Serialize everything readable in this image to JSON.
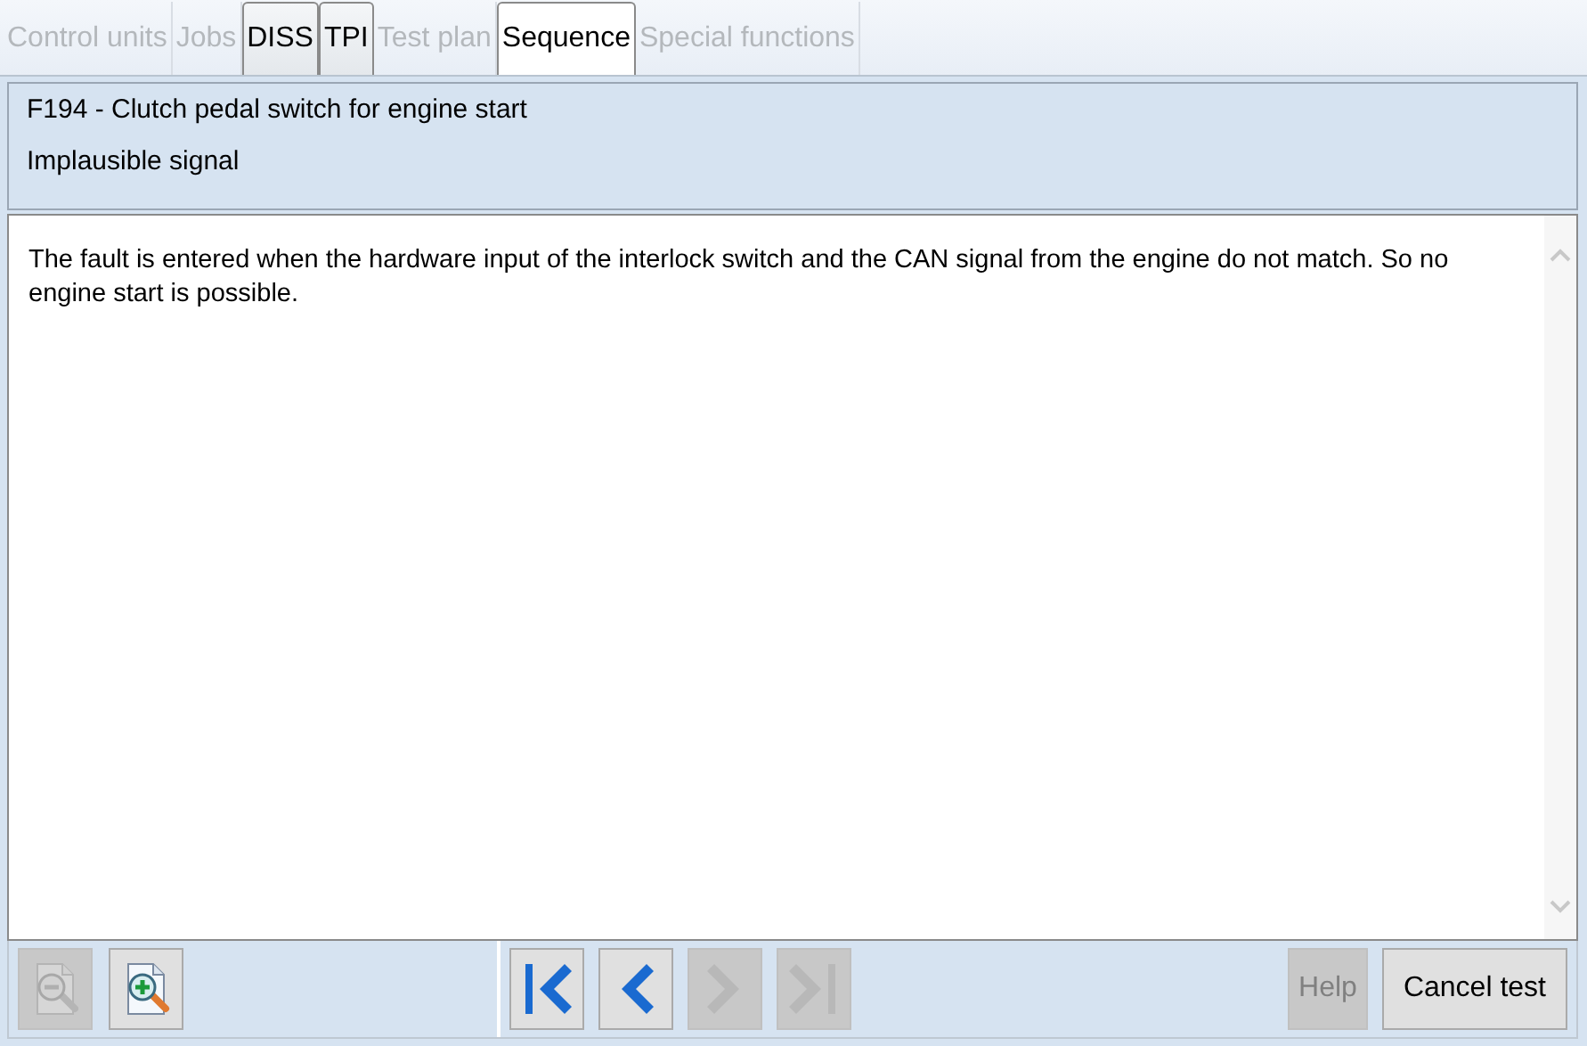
{
  "tabs": [
    {
      "label": "Control units",
      "disabled": true,
      "selected": false
    },
    {
      "label": "Jobs",
      "disabled": true,
      "selected": false
    },
    {
      "label": "DISS",
      "disabled": false,
      "selected": false
    },
    {
      "label": "TPI",
      "disabled": false,
      "selected": false
    },
    {
      "label": "Test plan",
      "disabled": true,
      "selected": false
    },
    {
      "label": "Sequence",
      "disabled": false,
      "selected": true
    },
    {
      "label": "Special functions",
      "disabled": true,
      "selected": false
    }
  ],
  "header": {
    "title": "F194 - Clutch pedal switch for engine start",
    "subtitle": "Implausible signal"
  },
  "description": "The fault is entered when the hardware input of the interlock switch and the CAN signal from the engine do not match. So no engine start is possible.",
  "toolbar": {
    "zoom_buttons": [
      {
        "kind": "zoom-out",
        "disabled": true
      },
      {
        "kind": "zoom-in",
        "disabled": false
      }
    ],
    "nav_buttons": [
      {
        "kind": "first",
        "disabled": false
      },
      {
        "kind": "previous",
        "disabled": false
      },
      {
        "kind": "next",
        "disabled": true
      },
      {
        "kind": "last",
        "disabled": true
      }
    ],
    "text_buttons": [
      {
        "label": "Help",
        "disabled": true
      },
      {
        "label": "Cancel test",
        "disabled": false
      }
    ]
  }
}
